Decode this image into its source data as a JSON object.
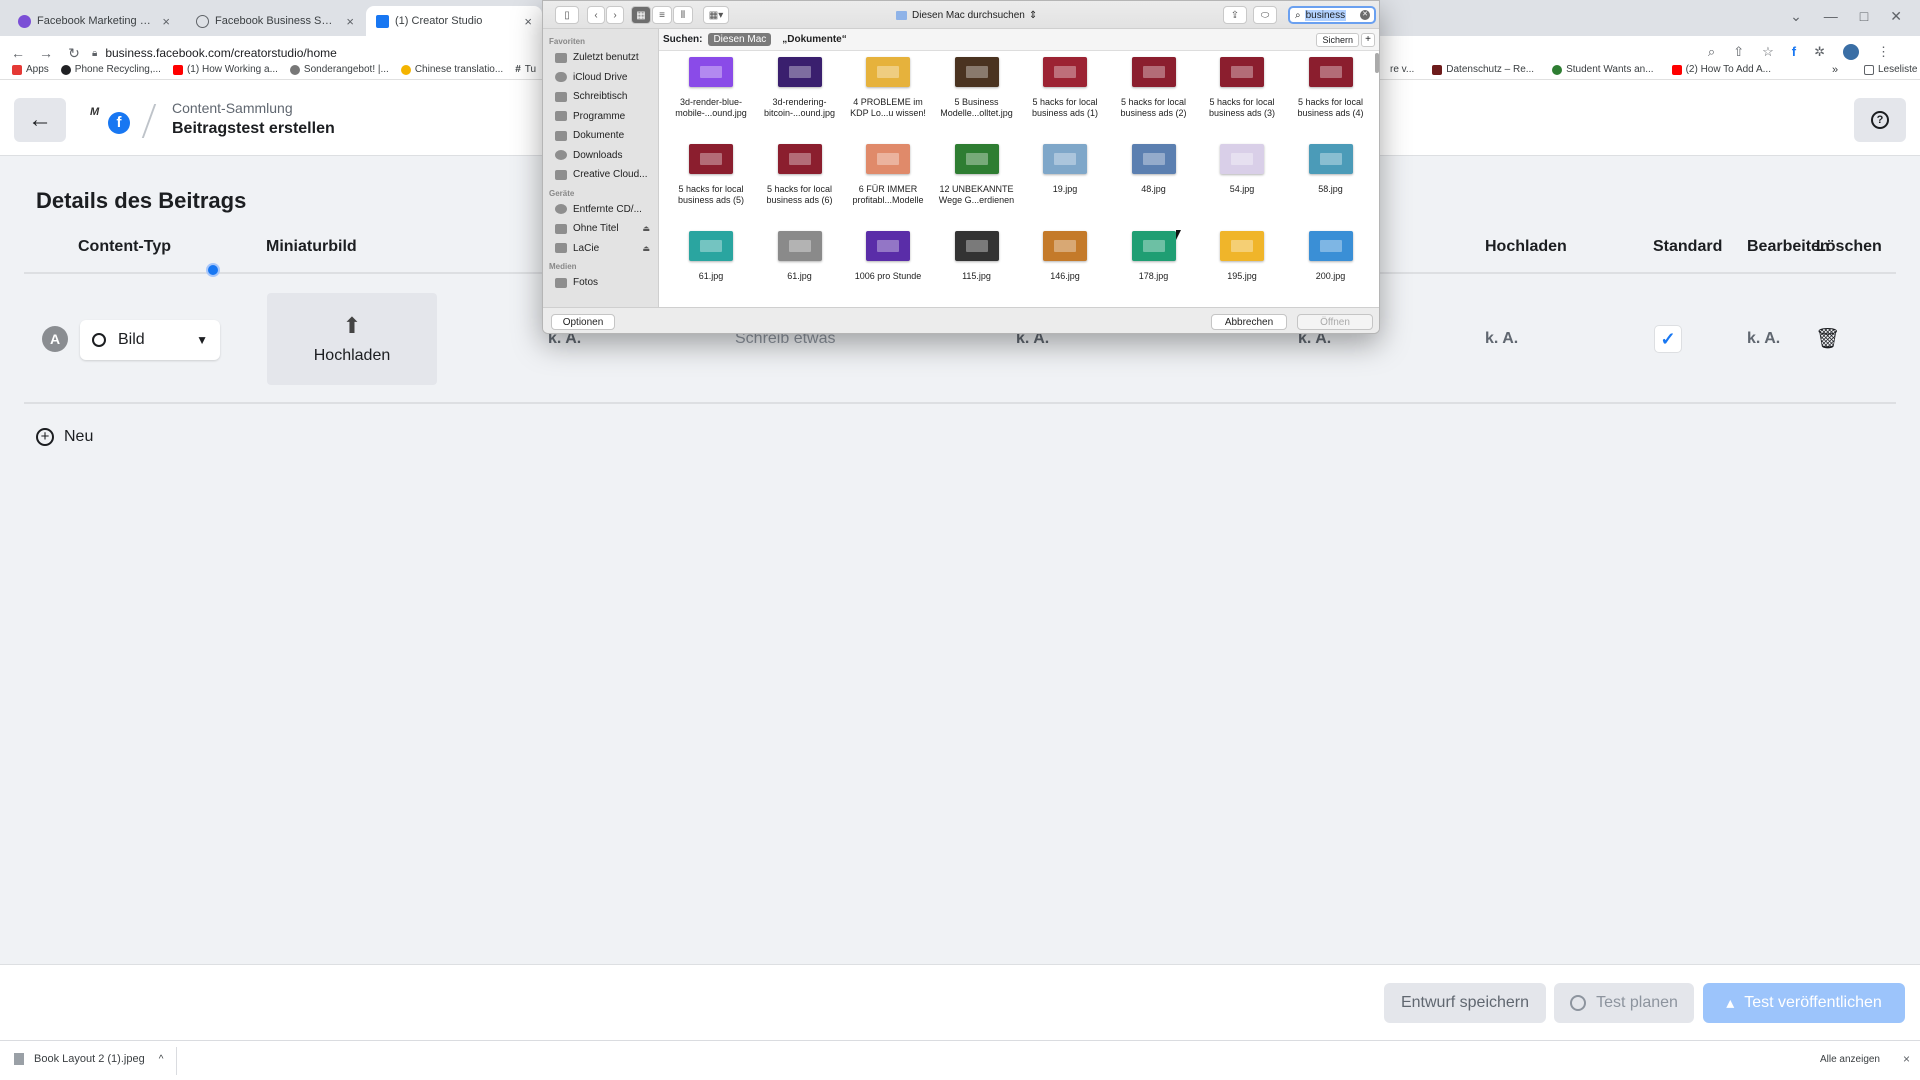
{
  "browser": {
    "tabs": [
      {
        "title": "Facebook Marketing & Werbe…",
        "close": "×",
        "color": "#7b4fd6"
      },
      {
        "title": "Facebook Business Suite",
        "close": "×",
        "color": "#5f6368"
      },
      {
        "title": "(1) Creator Studio",
        "close": "×",
        "color": "#1877f2"
      }
    ],
    "url": "business.facebook.com/creatorstudio/home",
    "bookmarks": [
      {
        "label": "Apps",
        "color": "#e53935"
      },
      {
        "label": "Phone Recycling,...",
        "color": "#202124"
      },
      {
        "label": "(1) How Working a...",
        "color": "#ff0000"
      },
      {
        "label": "Sonderangebot! |...",
        "color": "#777777"
      },
      {
        "label": "Chinese translatio...",
        "color": "#f4b400"
      },
      {
        "label": "Tu",
        "color": "#222222"
      }
    ],
    "bookmarks_right": [
      {
        "label": "re v...",
        "color": "#999999"
      },
      {
        "label": "Datenschutz – Re...",
        "color": "#6d1b1b"
      },
      {
        "label": "Student Wants an...",
        "color": "#2e7d32"
      },
      {
        "label": "(2) How To Add A...",
        "color": "#ff0000"
      }
    ],
    "reading_list": "Leseliste",
    "more_bookmarks": "»"
  },
  "header": {
    "subtitle": "Content-Sammlung",
    "title": "Beitragstest erstellen",
    "help": "?"
  },
  "main": {
    "section_title": "Details des Beitrags",
    "columns": {
      "content_type": "Content-Typ",
      "thumbnail": "Miniaturbild",
      "upload": "Hochladen",
      "standard": "Standard",
      "edit": "Bearbeiten",
      "delete": "Löschen"
    },
    "row": {
      "avatar": "A",
      "content_type_value": "Bild",
      "thumbnail_button": "Hochladen",
      "ka1": "k. A.",
      "text_placeholder": "Schreib etwas",
      "ka2": "k. A.",
      "ka3": "k. A.",
      "ka4": "k. A.",
      "ka5": "k. A."
    },
    "new_label": "Neu"
  },
  "footer": {
    "save_draft": "Entwurf speichern",
    "plan_test": "Test planen",
    "publish_test": "Test veröffentlichen"
  },
  "downloads": {
    "file": "Book Layout 2 (1).jpeg",
    "show_all": "Alle anzeigen",
    "close": "×"
  },
  "dialog": {
    "location": "Diesen Mac durchsuchen",
    "search_value": "business",
    "sidebar": {
      "favorites_head": "Favoriten",
      "favorites": [
        "Zuletzt benutzt",
        "iCloud Drive",
        "Schreibtisch",
        "Programme",
        "Dokumente",
        "Downloads",
        "Creative Cloud..."
      ],
      "devices_head": "Geräte",
      "devices": [
        "Entfernte CD/...",
        "Ohne Titel",
        "LaCie"
      ],
      "media_head": "Medien",
      "media": [
        "Fotos"
      ]
    },
    "scope": {
      "label": "Suchen:",
      "this_mac": "Diesen Mac",
      "documents": "„Dokumente“",
      "save": "Sichern",
      "add": "+"
    },
    "files": [
      {
        "name": "3d-render-blue-mobile-...ound.jpg",
        "color": "#8a4be8"
      },
      {
        "name": "3d-rendering-bitcoin-...ound.jpg",
        "color": "#3a1f6e"
      },
      {
        "name": "4 PROBLEME im KDP Lo...u wissen!",
        "color": "#e6b23c"
      },
      {
        "name": "5 Business Modelle...olltet.jpg",
        "color": "#4a3320"
      },
      {
        "name": "5 hacks for local business ads (1)",
        "color": "#9c2333"
      },
      {
        "name": "5 hacks for local business ads (2)",
        "color": "#8b1e2e"
      },
      {
        "name": "5 hacks for local business ads (3)",
        "color": "#8b1e2e"
      },
      {
        "name": "5 hacks for local business ads (4)",
        "color": "#8b1e2e"
      },
      {
        "name": "5 hacks for local business ads (5)",
        "color": "#8b1e2e"
      },
      {
        "name": "5 hacks for local business ads (6)",
        "color": "#8b1e2e"
      },
      {
        "name": "6 FÜR IMMER profitabl...Modelle",
        "color": "#e08a6a"
      },
      {
        "name": "12 UNBEKANNTE Wege G...erdienen",
        "color": "#2e7d32"
      },
      {
        "name": "19.jpg",
        "color": "#7fa7c9"
      },
      {
        "name": "48.jpg",
        "color": "#5b7fb0"
      },
      {
        "name": "54.jpg",
        "color": "#d9cfe8"
      },
      {
        "name": "58.jpg",
        "color": "#4b9bb8"
      },
      {
        "name": "61.jpg",
        "color": "#2aa5a0"
      },
      {
        "name": "61.jpg",
        "color": "#8a8a8a"
      },
      {
        "name": "1006 pro Stunde",
        "color": "#5a2da8"
      },
      {
        "name": "115.jpg",
        "color": "#333333"
      },
      {
        "name": "146.jpg",
        "color": "#c47a2a"
      },
      {
        "name": "178.jpg",
        "color": "#1f9e73"
      },
      {
        "name": "195.jpg",
        "color": "#f0b52a"
      },
      {
        "name": "200.jpg",
        "color": "#3a8fd6"
      }
    ],
    "options_button": "Optionen",
    "cancel_button": "Abbrechen",
    "open_button": "Öffnen"
  },
  "colors": {
    "accent": "#1877f2",
    "publish_disabled": "#9cc4fb"
  }
}
